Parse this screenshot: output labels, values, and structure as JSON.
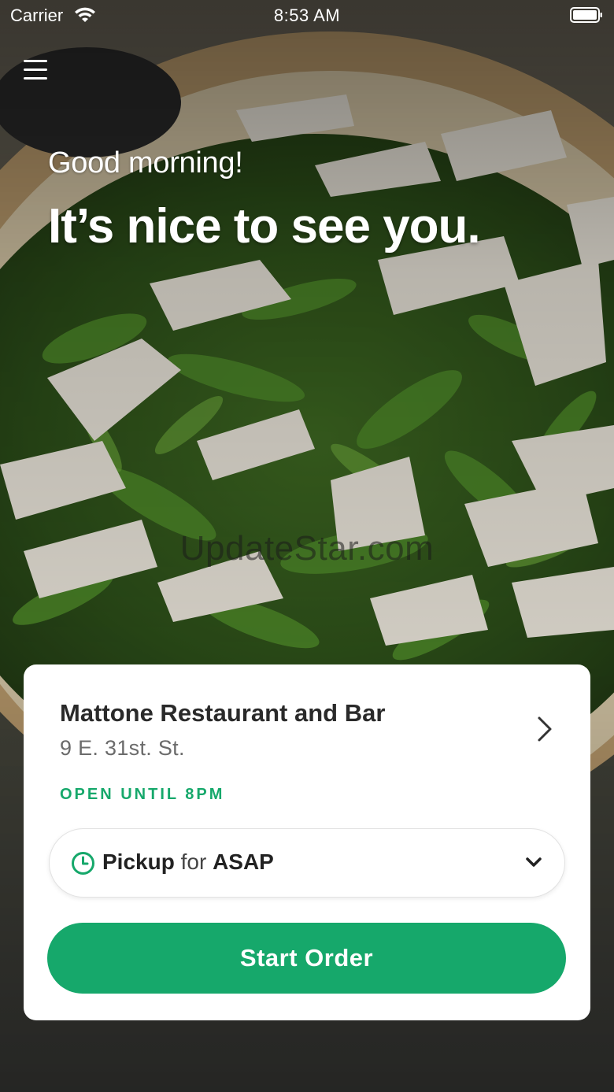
{
  "status_bar": {
    "carrier": "Carrier",
    "time": "8:53 AM",
    "wifi_icon": "wifi-icon",
    "battery_icon": "battery-full-icon"
  },
  "header": {
    "menu_icon": "hamburger-menu-icon"
  },
  "greeting": {
    "salutation": "Good morning!",
    "headline": "It’s nice to see you."
  },
  "watermark": "UpdateStar.com",
  "restaurant": {
    "name": "Mattone Restaurant and Bar",
    "address": "9 E. 31st. St.",
    "hours_status": "OPEN UNTIL 8PM"
  },
  "order_options": {
    "mode": "Pickup",
    "connector": "for",
    "time": "ASAP",
    "clock_icon": "clock-icon",
    "dropdown_icon": "chevron-down-icon"
  },
  "cta": {
    "start_order_label": "Start Order"
  },
  "colors": {
    "brand_green": "#16a86b",
    "card_background": "#ffffff",
    "text_dark": "#2a2a2a",
    "text_muted": "#6b6b6b"
  }
}
